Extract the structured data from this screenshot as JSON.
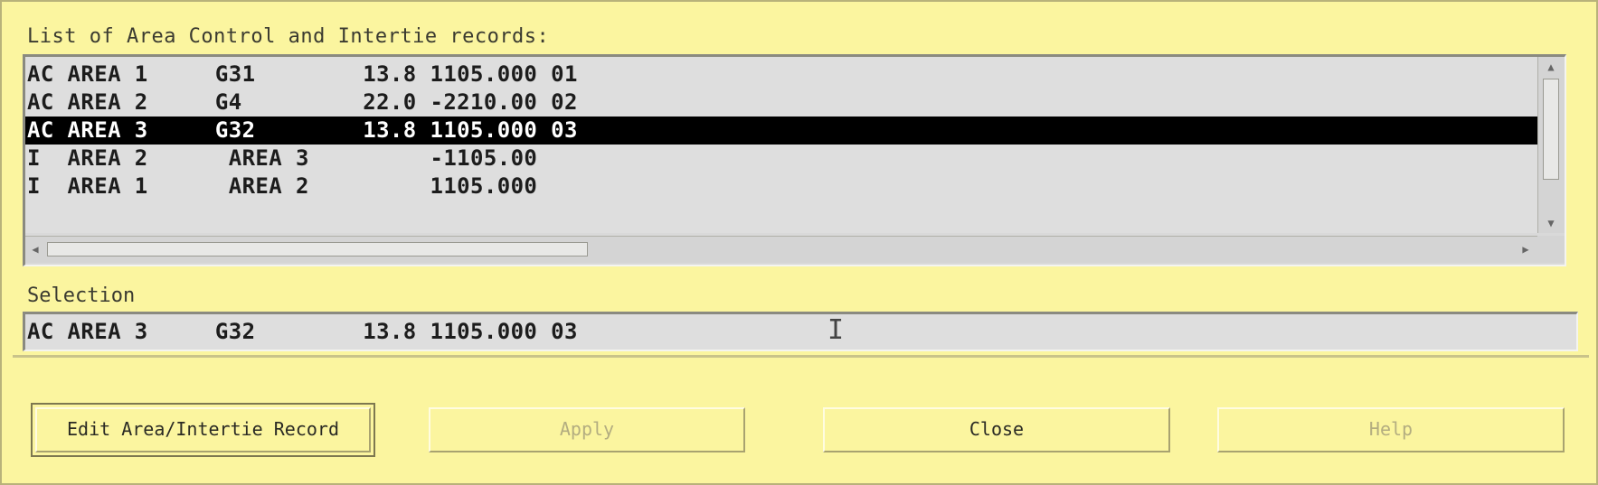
{
  "list": {
    "label": "List of Area Control and Intertie records:",
    "rows": [
      "AC AREA 1     G31        13.8 1105.000 01",
      "AC AREA 2     G4         22.0 -2210.00 02",
      "AC AREA 3     G32        13.8 1105.000 03",
      "I  AREA 2      AREA 3         -1105.00",
      "I  AREA 1      AREA 2         1105.000"
    ],
    "selected_index": 2
  },
  "selection": {
    "label": "Selection",
    "value": "AC AREA 3     G32        13.8 1105.000 03"
  },
  "buttons": {
    "edit": "Edit Area/Intertie Record",
    "apply": "Apply",
    "close": "Close",
    "help": "Help"
  },
  "colors": {
    "window_bg": "#fbf59f",
    "list_bg": "#dedede",
    "selected_bg": "#000000",
    "selected_fg": "#ffffff"
  }
}
